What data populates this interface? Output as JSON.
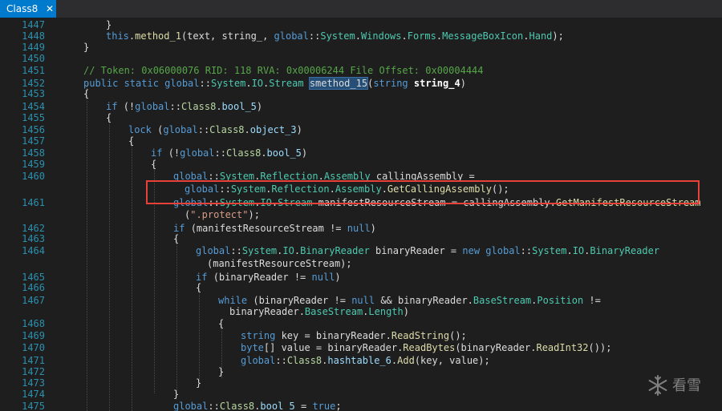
{
  "tab": {
    "title": "Class8",
    "close_glyph": "✕"
  },
  "colors": {
    "background": "#1e1e1e",
    "tab_active": "#007acc",
    "line_number": "#2b91af",
    "highlight_box": "#e8413a",
    "keyword": "#569cd6",
    "type": "#4ec9b0",
    "string": "#d69d85",
    "comment": "#57a64a",
    "method": "#dcdcaa"
  },
  "code_lines": [
    {
      "num": "1447",
      "tokens": [
        [
          "p",
          "}"
        ]
      ]
    },
    {
      "num": "1448",
      "tokens": [
        [
          "kw",
          "this"
        ],
        [
          "p",
          "."
        ],
        [
          "mt",
          "method_1"
        ],
        [
          "p",
          "(text, string_, "
        ],
        [
          "kw",
          "global"
        ],
        [
          "p",
          "::"
        ],
        [
          "ty",
          "System"
        ],
        [
          "p",
          "."
        ],
        [
          "ty",
          "Windows"
        ],
        [
          "p",
          "."
        ],
        [
          "ty",
          "Forms"
        ],
        [
          "p",
          "."
        ],
        [
          "ty",
          "MessageBoxIcon"
        ],
        [
          "p",
          "."
        ],
        [
          "ty",
          "Hand"
        ],
        [
          "p",
          ");"
        ]
      ]
    },
    {
      "num": "1449",
      "tokens": [
        [
          "p",
          "}"
        ]
      ]
    },
    {
      "num": "1450",
      "tokens": []
    },
    {
      "num": "1451",
      "tokens": [
        [
          "cm",
          "// Token: 0x06000076 RID: 118 RVA: 0x00006244 File Offset: 0x00004444"
        ]
      ]
    },
    {
      "num": "1452",
      "tokens": [
        [
          "kw",
          "public static "
        ],
        [
          "kw",
          "global"
        ],
        [
          "p",
          "::"
        ],
        [
          "ty",
          "System"
        ],
        [
          "p",
          "."
        ],
        [
          "ty",
          "IO"
        ],
        [
          "p",
          "."
        ],
        [
          "ty",
          "Stream "
        ],
        [
          "sel",
          "smethod_15"
        ],
        [
          "p",
          "("
        ],
        [
          "kw",
          "string "
        ],
        [
          "bold",
          "string_4"
        ],
        [
          "p",
          ")"
        ]
      ]
    },
    {
      "num": "1453",
      "tokens": [
        [
          "p",
          "{"
        ]
      ]
    },
    {
      "num": "1454",
      "tokens": [
        [
          "kw",
          "if "
        ],
        [
          "p",
          "(!"
        ],
        [
          "kw",
          "global"
        ],
        [
          "p",
          "::"
        ],
        [
          "cls",
          "Class8"
        ],
        [
          "p",
          "."
        ],
        [
          "pr",
          "bool_5"
        ],
        [
          "p",
          ")"
        ]
      ]
    },
    {
      "num": "1455",
      "tokens": [
        [
          "p",
          "{"
        ]
      ]
    },
    {
      "num": "1456",
      "tokens": [
        [
          "kw",
          "lock "
        ],
        [
          "p",
          "("
        ],
        [
          "kw",
          "global"
        ],
        [
          "p",
          "::"
        ],
        [
          "cls",
          "Class8"
        ],
        [
          "p",
          "."
        ],
        [
          "pr",
          "object_3"
        ],
        [
          "p",
          ")"
        ]
      ]
    },
    {
      "num": "1457",
      "tokens": [
        [
          "p",
          "{"
        ]
      ]
    },
    {
      "num": "1458",
      "tokens": [
        [
          "kw",
          "if "
        ],
        [
          "p",
          "(!"
        ],
        [
          "kw",
          "global"
        ],
        [
          "p",
          "::"
        ],
        [
          "cls",
          "Class8"
        ],
        [
          "p",
          "."
        ],
        [
          "pr",
          "bool_5"
        ],
        [
          "p",
          ")"
        ]
      ]
    },
    {
      "num": "1459",
      "tokens": [
        [
          "p",
          "{"
        ]
      ]
    },
    {
      "num": "1460",
      "tokens": [
        [
          "kw",
          "global"
        ],
        [
          "p",
          "::"
        ],
        [
          "ty",
          "System"
        ],
        [
          "p",
          "."
        ],
        [
          "ty",
          "Reflection"
        ],
        [
          "p",
          "."
        ],
        [
          "ty",
          "Assembly "
        ],
        [
          "p",
          "callingAssembly ="
        ]
      ]
    },
    {
      "num": "",
      "tokens": [
        [
          "kw",
          "global"
        ],
        [
          "p",
          "::"
        ],
        [
          "ty",
          "System"
        ],
        [
          "p",
          "."
        ],
        [
          "ty",
          "Reflection"
        ],
        [
          "p",
          "."
        ],
        [
          "ty",
          "Assembly"
        ],
        [
          "p",
          "."
        ],
        [
          "mt",
          "GetCallingAssembly"
        ],
        [
          "p",
          "();"
        ]
      ]
    },
    {
      "num": "1461",
      "tokens": [
        [
          "kw",
          "global"
        ],
        [
          "p",
          "::"
        ],
        [
          "ty",
          "System"
        ],
        [
          "p",
          "."
        ],
        [
          "ty",
          "IO"
        ],
        [
          "p",
          "."
        ],
        [
          "ty",
          "Stream "
        ],
        [
          "p",
          "manifestResourceStream = callingAssembly."
        ],
        [
          "mt",
          "GetManifestResourceStream"
        ]
      ]
    },
    {
      "num": "",
      "tokens": [
        [
          "p",
          "("
        ],
        [
          "str",
          "\".protect\""
        ],
        [
          "p",
          ");"
        ]
      ]
    },
    {
      "num": "1462",
      "tokens": [
        [
          "kw",
          "if "
        ],
        [
          "p",
          "(manifestResourceStream != "
        ],
        [
          "kw",
          "null"
        ],
        [
          "p",
          ")"
        ]
      ]
    },
    {
      "num": "1463",
      "tokens": [
        [
          "p",
          "{"
        ]
      ]
    },
    {
      "num": "1464",
      "tokens": [
        [
          "kw",
          "global"
        ],
        [
          "p",
          "::"
        ],
        [
          "ty",
          "System"
        ],
        [
          "p",
          "."
        ],
        [
          "ty",
          "IO"
        ],
        [
          "p",
          "."
        ],
        [
          "ty",
          "BinaryReader "
        ],
        [
          "p",
          "binaryReader = "
        ],
        [
          "kw",
          "new global"
        ],
        [
          "p",
          "::"
        ],
        [
          "ty",
          "System"
        ],
        [
          "p",
          "."
        ],
        [
          "ty",
          "IO"
        ],
        [
          "p",
          "."
        ],
        [
          "ty",
          "BinaryReader"
        ]
      ]
    },
    {
      "num": "",
      "tokens": [
        [
          "p",
          "(manifestResourceStream);"
        ]
      ]
    },
    {
      "num": "1465",
      "tokens": [
        [
          "kw",
          "if "
        ],
        [
          "p",
          "(binaryReader != "
        ],
        [
          "kw",
          "null"
        ],
        [
          "p",
          ")"
        ]
      ]
    },
    {
      "num": "1466",
      "tokens": [
        [
          "p",
          "{"
        ]
      ]
    },
    {
      "num": "1467",
      "tokens": [
        [
          "kw",
          "while "
        ],
        [
          "p",
          "(binaryReader != "
        ],
        [
          "kw",
          "null "
        ],
        [
          "p",
          "&& binaryReader."
        ],
        [
          "ty",
          "BaseStream"
        ],
        [
          "p",
          "."
        ],
        [
          "ty",
          "Position "
        ],
        [
          "p",
          "!="
        ]
      ]
    },
    {
      "num": "",
      "tokens": [
        [
          "p",
          "binaryReader."
        ],
        [
          "ty",
          "BaseStream"
        ],
        [
          "p",
          "."
        ],
        [
          "ty",
          "Length"
        ],
        [
          "p",
          ")"
        ]
      ]
    },
    {
      "num": "1468",
      "tokens": [
        [
          "p",
          "{"
        ]
      ]
    },
    {
      "num": "1469",
      "tokens": [
        [
          "kw",
          "string "
        ],
        [
          "p",
          "key = binaryReader."
        ],
        [
          "mt",
          "ReadString"
        ],
        [
          "p",
          "();"
        ]
      ]
    },
    {
      "num": "1470",
      "tokens": [
        [
          "kw",
          "byte"
        ],
        [
          "p",
          "[] value = binaryReader."
        ],
        [
          "mt",
          "ReadBytes"
        ],
        [
          "p",
          "(binaryReader."
        ],
        [
          "mt",
          "ReadInt32"
        ],
        [
          "p",
          "());"
        ]
      ]
    },
    {
      "num": "1471",
      "tokens": [
        [
          "kw",
          "global"
        ],
        [
          "p",
          "::"
        ],
        [
          "cls",
          "Class8"
        ],
        [
          "p",
          "."
        ],
        [
          "pr",
          "hashtable_6"
        ],
        [
          "p",
          "."
        ],
        [
          "mt",
          "Add"
        ],
        [
          "p",
          "(key, value);"
        ]
      ]
    },
    {
      "num": "1472",
      "tokens": [
        [
          "p",
          "}"
        ]
      ]
    },
    {
      "num": "1473",
      "tokens": [
        [
          "p",
          "}"
        ]
      ]
    },
    {
      "num": "1474",
      "tokens": [
        [
          "p",
          "}"
        ]
      ]
    },
    {
      "num": "1475",
      "tokens": [
        [
          "kw",
          "global"
        ],
        [
          "p",
          "::"
        ],
        [
          "cls",
          "Class8"
        ],
        [
          "p",
          "."
        ],
        [
          "pr",
          "bool_5 "
        ],
        [
          "p",
          "= "
        ],
        [
          "kw",
          "true"
        ],
        [
          "p",
          ";"
        ]
      ]
    }
  ],
  "watermark": {
    "text": "看雪",
    "icon": "snowflake-icon"
  }
}
